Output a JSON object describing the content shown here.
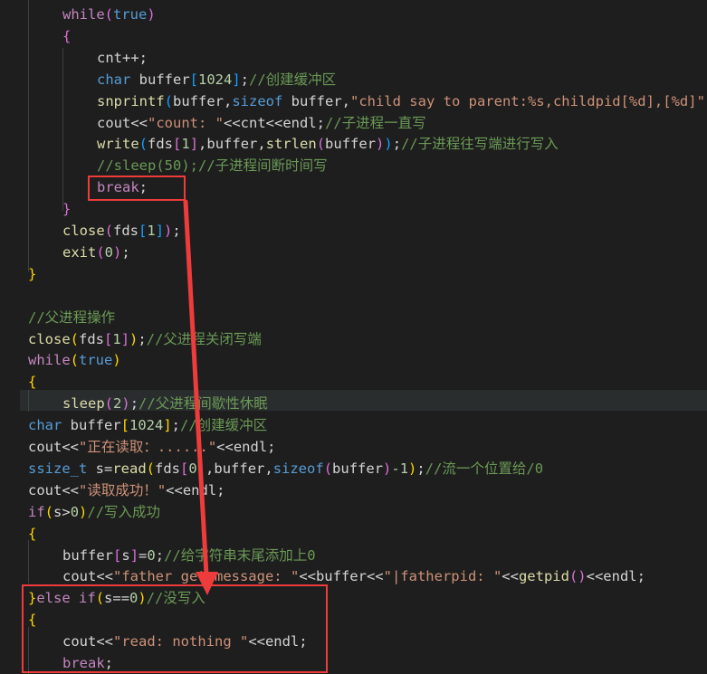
{
  "editor": {
    "colors": {
      "background": "#1e1e1e",
      "keyword": "#569cd6",
      "control": "#c586c0",
      "function": "#dcdcaa",
      "string": "#ce9178",
      "number": "#b5cea8",
      "comment": "#6a9955",
      "bracket_gold": "#ffd700",
      "bracket_purple": "#da70d6",
      "bracket_blue": "#179fff",
      "default": "#d4d4d4",
      "annotation": "#ee3b3b"
    },
    "lines": [
      {
        "id": "l01",
        "tokens": [
          [
            "while",
            "c"
          ],
          [
            "(",
            "p"
          ],
          [
            "true",
            "k"
          ],
          [
            ")",
            "p"
          ]
        ]
      },
      {
        "id": "l02",
        "tokens": [
          [
            "{",
            "p"
          ]
        ]
      },
      {
        "id": "l03",
        "tokens": [
          [
            "cnt++;",
            "d"
          ]
        ]
      },
      {
        "id": "l04",
        "tokens": [
          [
            "char",
            "k"
          ],
          [
            " buffer",
            "d"
          ],
          [
            "[",
            "b"
          ],
          [
            "1024",
            "n"
          ],
          [
            "]",
            "b"
          ],
          [
            ";",
            "d"
          ],
          [
            "//创建缓冲区",
            "m"
          ]
        ]
      },
      {
        "id": "l05",
        "tokens": [
          [
            "snprintf",
            "f"
          ],
          [
            "(",
            "b"
          ],
          [
            "buffer,",
            "d"
          ],
          [
            "sizeof",
            "k"
          ],
          [
            " buffer,",
            "d"
          ],
          [
            "\"child say to parent:%s,childpid[%d],[%d]\"",
            "s"
          ]
        ]
      },
      {
        "id": "l06",
        "tokens": [
          [
            "cout<<",
            "d"
          ],
          [
            "\"count: \"",
            "s"
          ],
          [
            "<<cnt<<endl;",
            "d"
          ],
          [
            "//子进程一直写",
            "m"
          ]
        ]
      },
      {
        "id": "l07",
        "tokens": [
          [
            "write",
            "f"
          ],
          [
            "(",
            "b"
          ],
          [
            "fds",
            "d"
          ],
          [
            "[",
            "p"
          ],
          [
            "1",
            "n"
          ],
          [
            "]",
            "p"
          ],
          [
            ",buffer,",
            "d"
          ],
          [
            "strlen",
            "f"
          ],
          [
            "(",
            "p"
          ],
          [
            "buffer",
            "d"
          ],
          [
            ")",
            "p"
          ],
          [
            ")",
            "b"
          ],
          [
            ";",
            "d"
          ],
          [
            "//子进程往写端进行写入",
            "m"
          ]
        ]
      },
      {
        "id": "l08",
        "tokens": [
          [
            "//sleep(50);//子进程间断时间写",
            "m"
          ]
        ]
      },
      {
        "id": "l09",
        "tokens": [
          [
            "break",
            "c"
          ],
          [
            ";",
            "d"
          ]
        ]
      },
      {
        "id": "l10",
        "tokens": [
          [
            "}",
            "p"
          ]
        ]
      },
      {
        "id": "l11",
        "tokens": [
          [
            "close",
            "f"
          ],
          [
            "(",
            "p"
          ],
          [
            "fds",
            "d"
          ],
          [
            "[",
            "b"
          ],
          [
            "1",
            "n"
          ],
          [
            "]",
            "b"
          ],
          [
            ")",
            "p"
          ],
          [
            ";",
            "d"
          ]
        ]
      },
      {
        "id": "l12",
        "tokens": [
          [
            "exit",
            "f"
          ],
          [
            "(",
            "p"
          ],
          [
            "0",
            "n"
          ],
          [
            ")",
            "p"
          ],
          [
            ";",
            "d"
          ]
        ]
      },
      {
        "id": "l13",
        "tokens": [
          [
            "}",
            "g"
          ]
        ]
      },
      {
        "id": "l14",
        "tokens": []
      },
      {
        "id": "l15",
        "tokens": [
          [
            "//父进程操作",
            "m"
          ]
        ]
      },
      {
        "id": "l16",
        "tokens": [
          [
            "close",
            "f"
          ],
          [
            "(",
            "g"
          ],
          [
            "fds",
            "d"
          ],
          [
            "[",
            "p"
          ],
          [
            "1",
            "n"
          ],
          [
            "]",
            "p"
          ],
          [
            ")",
            "g"
          ],
          [
            ";",
            "d"
          ],
          [
            "//父进程关闭写端",
            "m"
          ]
        ]
      },
      {
        "id": "l17",
        "tokens": [
          [
            "while",
            "c"
          ],
          [
            "(",
            "g"
          ],
          [
            "true",
            "k"
          ],
          [
            ")",
            "g"
          ]
        ]
      },
      {
        "id": "l18",
        "tokens": [
          [
            "{",
            "g"
          ]
        ]
      },
      {
        "id": "l19",
        "tokens": [
          [
            "sleep",
            "f"
          ],
          [
            "(",
            "p"
          ],
          [
            "2",
            "n"
          ],
          [
            ")",
            "p"
          ],
          [
            ";",
            "d"
          ],
          [
            "//父进程间歇性休眠",
            "m"
          ]
        ]
      },
      {
        "id": "l20",
        "tokens": [
          [
            "char",
            "k"
          ],
          [
            " buffer",
            "d"
          ],
          [
            "[",
            "g"
          ],
          [
            "1024",
            "n"
          ],
          [
            "]",
            "g"
          ],
          [
            ";",
            "d"
          ],
          [
            "//创建缓冲区",
            "m"
          ]
        ]
      },
      {
        "id": "l21",
        "tokens": [
          [
            "cout<<",
            "d"
          ],
          [
            "\"正在读取：......\"",
            "s"
          ],
          [
            "<<endl;",
            "d"
          ]
        ]
      },
      {
        "id": "l22",
        "tokens": [
          [
            "ssize_t",
            "k"
          ],
          [
            " s=",
            "d"
          ],
          [
            "read",
            "f"
          ],
          [
            "(",
            "g"
          ],
          [
            "fds",
            "d"
          ],
          [
            "[",
            "p"
          ],
          [
            "0",
            "n"
          ],
          [
            "]",
            "p"
          ],
          [
            ",buffer,",
            "d"
          ],
          [
            "sizeof",
            "k"
          ],
          [
            "(",
            "p"
          ],
          [
            "buffer",
            "d"
          ],
          [
            ")",
            "p"
          ],
          [
            "-1",
            "n"
          ],
          [
            ")",
            "g"
          ],
          [
            ";",
            "d"
          ],
          [
            "//流一个位置给/0",
            "m"
          ]
        ]
      },
      {
        "id": "l23",
        "tokens": [
          [
            "cout<<",
            "d"
          ],
          [
            "\"读取成功！\"",
            "s"
          ],
          [
            "<<endl;",
            "d"
          ]
        ]
      },
      {
        "id": "l24",
        "tokens": [
          [
            "if",
            "c"
          ],
          [
            "(",
            "g"
          ],
          [
            "s>",
            "d"
          ],
          [
            "0",
            "n"
          ],
          [
            ")",
            "g"
          ],
          [
            "//写入成功",
            "m"
          ]
        ]
      },
      {
        "id": "l25",
        "tokens": [
          [
            "{",
            "g"
          ]
        ]
      },
      {
        "id": "l26",
        "tokens": [
          [
            "buffer",
            "d"
          ],
          [
            "[",
            "p"
          ],
          [
            "s",
            "d"
          ],
          [
            "]",
            "p"
          ],
          [
            "=",
            "d"
          ],
          [
            "0",
            "n"
          ],
          [
            ";",
            "d"
          ],
          [
            "//给字符串末尾添加上0",
            "m"
          ]
        ]
      },
      {
        "id": "l27",
        "tokens": [
          [
            "cout<<",
            "d"
          ],
          [
            "\"father get message: \"",
            "s"
          ],
          [
            "<<buffer<<",
            "d"
          ],
          [
            "\"|fatherpid: \"",
            "s"
          ],
          [
            "<<",
            "d"
          ],
          [
            "getpid",
            "f"
          ],
          [
            "()",
            "p"
          ],
          [
            "<<endl;",
            "d"
          ]
        ]
      },
      {
        "id": "l28",
        "tokens": [
          [
            "}",
            "g"
          ],
          [
            "else ",
            "c"
          ],
          [
            "if",
            "c"
          ],
          [
            "(",
            "g"
          ],
          [
            "s==",
            "d"
          ],
          [
            "0",
            "n"
          ],
          [
            ")",
            "g"
          ],
          [
            "//没写入",
            "m"
          ]
        ]
      },
      {
        "id": "l29",
        "tokens": [
          [
            "{",
            "g"
          ]
        ]
      },
      {
        "id": "l30",
        "tokens": [
          [
            "cout<<",
            "d"
          ],
          [
            "\"read: nothing \"",
            "s"
          ],
          [
            "<<endl;",
            "d"
          ]
        ]
      },
      {
        "id": "l31",
        "tokens": [
          [
            "break",
            "c"
          ],
          [
            ";",
            "d"
          ]
        ]
      }
    ]
  }
}
